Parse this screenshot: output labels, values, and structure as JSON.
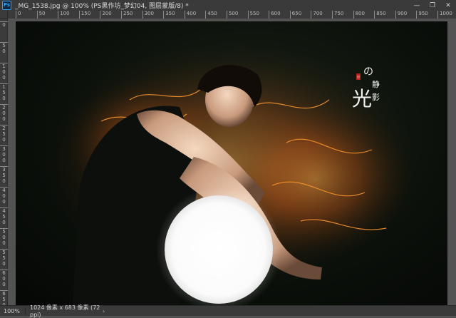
{
  "window": {
    "app_icon": "Ps",
    "title": "_MG_1538.jpg @ 100% (PS黑作坊_梦幻04, 图层蒙版/8) *",
    "minimize": "—",
    "restore": "❐",
    "close": "✕"
  },
  "ruler": {
    "horizontal": [
      "0",
      "50",
      "100",
      "150",
      "200",
      "250",
      "300",
      "350",
      "400",
      "450",
      "500",
      "550",
      "600",
      "650",
      "700",
      "750",
      "800",
      "850",
      "900",
      "950",
      "1000"
    ],
    "vertical": [
      "0",
      "50",
      "100",
      "150",
      "200",
      "250",
      "300",
      "350",
      "400",
      "450",
      "500",
      "550",
      "600",
      "650"
    ]
  },
  "artwork": {
    "calligraphy_1": "の",
    "calligraphy_2": "静",
    "calligraphy_3": "影",
    "calligraphy_4": "光",
    "seal": "印",
    "colors": {
      "background": "#0c110b",
      "fire": "#ff8a1e",
      "orb": "#ffffff"
    }
  },
  "status": {
    "zoom": "100%",
    "doc_size": "1024 像素 x 683 像素 (72 ppi)",
    "menu_arrow": "›"
  }
}
